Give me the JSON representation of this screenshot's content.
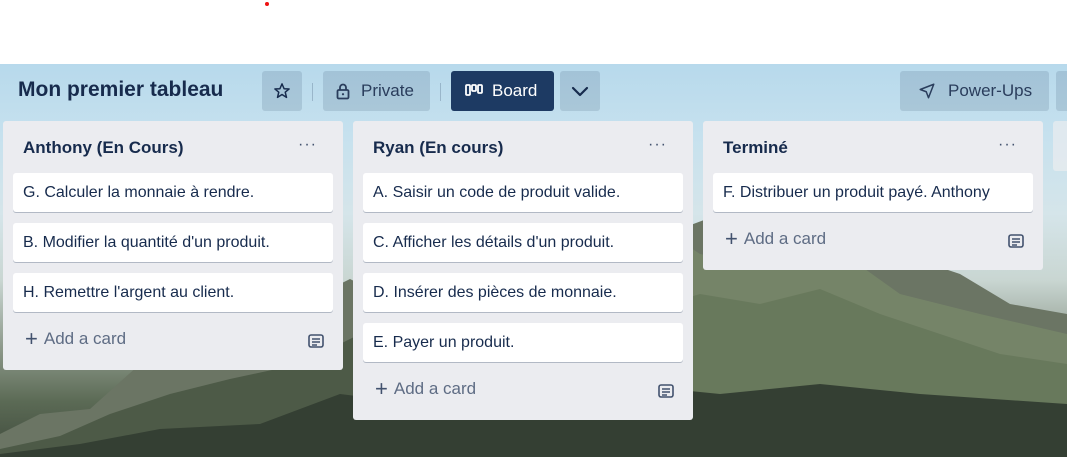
{
  "board": {
    "title": "Mon premier tableau",
    "visibility_label": "Private",
    "view_label": "Board",
    "powerups_label": "Power-Ups"
  },
  "icons": {
    "star": "star-icon",
    "lock": "lock-icon",
    "board": "board-icon",
    "chevron": "chevron-down-icon",
    "rocket": "rocket-icon",
    "template": "card-template-icon"
  },
  "lists": [
    {
      "title": "Anthony (En Cours)",
      "cards": [
        "G. Calculer la monnaie à rendre.",
        "B. Modifier la quantité d'un produit.",
        "H. Remettre l'argent au client."
      ],
      "add_label": "Add a card"
    },
    {
      "title": "Ryan (En cours)",
      "cards": [
        "A. Saisir un code de produit valide.",
        "C. Afficher les détails d'un produit.",
        "D. Insérer des pièces de monnaie.",
        "E. Payer un produit."
      ],
      "add_label": "Add a card"
    },
    {
      "title": "Terminé",
      "cards": [
        "F. Distribuer un produit payé. Anthony"
      ],
      "add_label": "Add a card"
    }
  ],
  "list_menu_glyph": "···",
  "colors": {
    "header_dark_button": "#1d3a63",
    "list_bg": "#ebecf0",
    "title_text": "#172b4d"
  }
}
